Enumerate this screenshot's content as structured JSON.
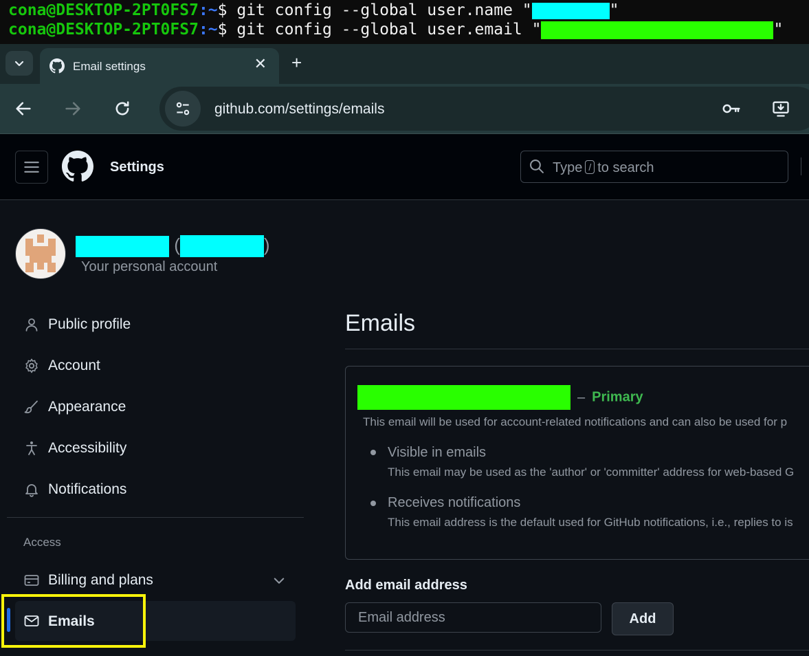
{
  "colors": {
    "redact_cyan": "#00ffff",
    "redact_green": "#29ff00",
    "accent_blue": "#1f6feb",
    "primary_green": "#3fb950",
    "highlight_yellow": "#f9f30a"
  },
  "terminal": {
    "lines": [
      {
        "user": "cona@DESKTOP-2PT0FS7",
        "path": ":~",
        "prompt": "$ ",
        "command": "git config --global user.name \"",
        "close": "\""
      },
      {
        "user": "cona@DESKTOP-2PT0FS7",
        "path": ":~",
        "prompt": "$ ",
        "command": "git config --global user.email \"",
        "close": "\""
      }
    ]
  },
  "browser": {
    "tab_title": "Email settings",
    "tab_close": "✕",
    "new_tab": "+",
    "tab_menu_icon": "chevron-down-icon",
    "url": "github.com/settings/emails"
  },
  "header": {
    "context_title": "Settings",
    "search_prefix": "Type",
    "search_key": "/",
    "search_suffix": "to search"
  },
  "account": {
    "paren_open": "(",
    "paren_close": ")",
    "subtitle": "Your personal account"
  },
  "sidebar": {
    "items": [
      {
        "label": "Public profile",
        "icon": "person-icon"
      },
      {
        "label": "Account",
        "icon": "gear-icon"
      },
      {
        "label": "Appearance",
        "icon": "paintbrush-icon"
      },
      {
        "label": "Accessibility",
        "icon": "accessibility-icon"
      },
      {
        "label": "Notifications",
        "icon": "bell-icon"
      }
    ],
    "access_label": "Access",
    "access_items": [
      {
        "label": "Billing and plans",
        "icon": "credit-card-icon"
      },
      {
        "label": "Emails",
        "icon": "mail-icon",
        "selected": true
      }
    ]
  },
  "main": {
    "title": "Emails",
    "primary_dash": "–",
    "primary_label": "Primary",
    "primary_desc": "This email will be used for account-related notifications and can also be used for p",
    "bullets": [
      {
        "title": "Visible in emails",
        "desc": "This email may be used as the 'author' or 'committer' address for web-based G"
      },
      {
        "title": "Receives notifications",
        "desc": "This email address is the default used for GitHub notifications, i.e., replies to is"
      }
    ],
    "add_label": "Add email address",
    "add_placeholder": "Email address",
    "add_button": "Add"
  }
}
